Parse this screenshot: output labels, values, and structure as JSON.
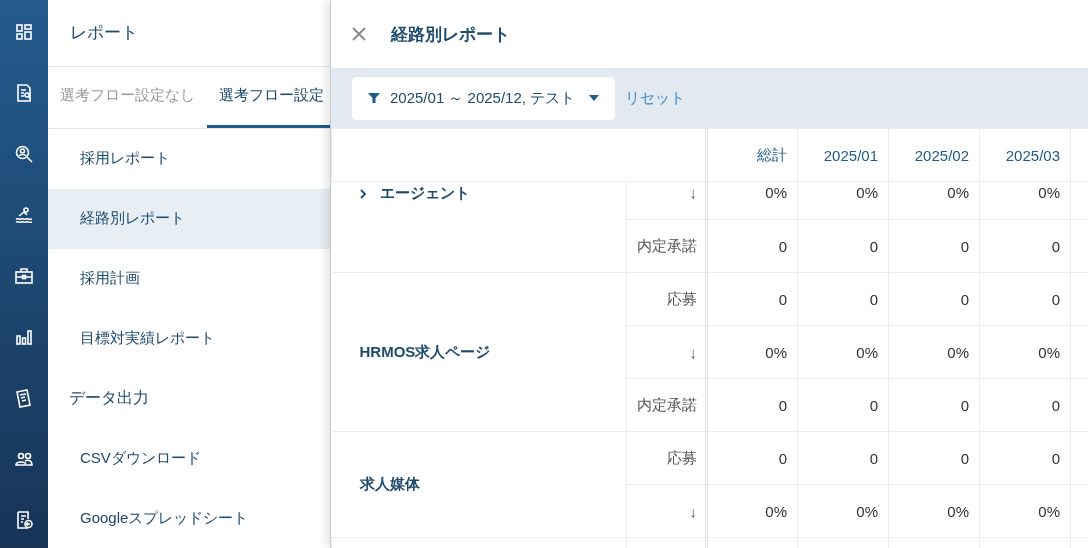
{
  "nav": {
    "title": "レポート",
    "tabs": [
      {
        "label": "選考フロー設定なし",
        "selected": false
      },
      {
        "label": "選考フロー設定",
        "selected": true
      }
    ],
    "items": [
      {
        "kind": "item",
        "label": "採用レポート",
        "selected": false
      },
      {
        "kind": "item",
        "label": "経路別レポート",
        "selected": true
      },
      {
        "kind": "item",
        "label": "採用計画",
        "selected": false
      },
      {
        "kind": "item",
        "label": "目標対実績レポート",
        "selected": false
      },
      {
        "kind": "section",
        "label": "データ出力"
      },
      {
        "kind": "item",
        "label": "CSVダウンロード",
        "selected": false
      },
      {
        "kind": "item",
        "label": "Googleスプレッドシート",
        "selected": false
      }
    ]
  },
  "panel": {
    "title": "経路別レポート",
    "filter": "2025/01 ～ 2025/12, テスト",
    "reset": "リセット",
    "columns": [
      "総計",
      "2025/01",
      "2025/02",
      "2025/03"
    ],
    "groups": [
      {
        "name": "エージェント",
        "expanded": false,
        "rows": [
          {
            "metric": "↓",
            "values": [
              "0%",
              "0%",
              "0%",
              "0%"
            ]
          },
          {
            "metric": "内定承諾",
            "values": [
              "0",
              "0",
              "0",
              "0"
            ]
          }
        ]
      },
      {
        "name": "HRMOS求人ページ",
        "rows": [
          {
            "metric": "応募",
            "values": [
              "0",
              "0",
              "0",
              "0"
            ]
          },
          {
            "metric": "↓",
            "values": [
              "0%",
              "0%",
              "0%",
              "0%"
            ]
          },
          {
            "metric": "内定承諾",
            "values": [
              "0",
              "0",
              "0",
              "0"
            ]
          }
        ]
      },
      {
        "name": "求人媒体",
        "rows": [
          {
            "metric": "応募",
            "values": [
              "0",
              "0",
              "0",
              "0"
            ]
          },
          {
            "metric": "↓",
            "values": [
              "0%",
              "0%",
              "0%",
              "0%"
            ]
          }
        ]
      }
    ]
  }
}
